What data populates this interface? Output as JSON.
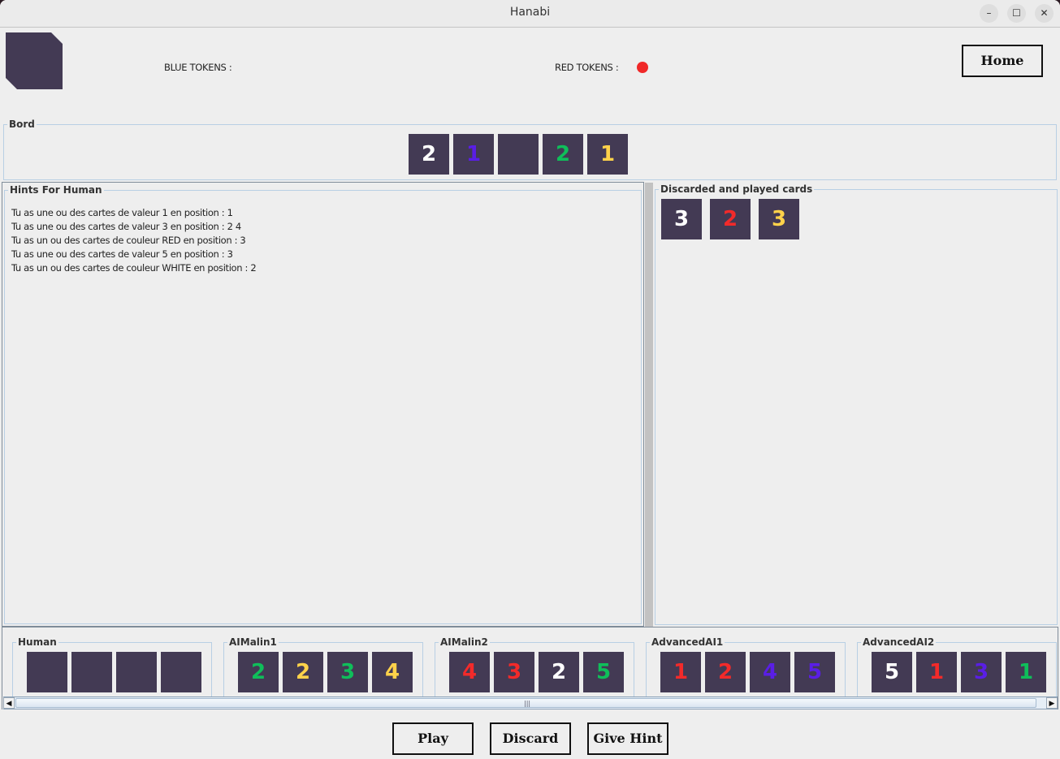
{
  "window": {
    "title": "Hanabi",
    "controls": {
      "minimize": "–",
      "maximize": "☐",
      "close": "✕"
    }
  },
  "header": {
    "blue_tokens_label": "BLUE TOKENS :",
    "red_tokens_label": "RED TOKENS :",
    "blue_tokens_count": 0,
    "red_tokens_count": 1,
    "home_label": "Home"
  },
  "colors": {
    "card_bg": "#433a54",
    "white": "#ffffff",
    "blue": "#5a1ee6",
    "green": "#0fbe5a",
    "yellow": "#ffd24a",
    "red": "#f22a2a",
    "red_token": "#f02828"
  },
  "bord": {
    "title": "Bord",
    "cards": [
      {
        "value": "2",
        "color": "white"
      },
      {
        "value": "1",
        "color": "blue"
      },
      {
        "value": "",
        "color": "none"
      },
      {
        "value": "2",
        "color": "green"
      },
      {
        "value": "1",
        "color": "yellow"
      }
    ]
  },
  "hints": {
    "title": "Hints For Human",
    "lines": [
      "Tu as une ou des cartes de valeur 1 en position : 1",
      "Tu as une ou des cartes de valeur 3 en position : 2 4",
      "Tu as un ou des cartes de couleur RED en position : 3",
      "Tu as une ou des cartes de valeur 5 en position : 3",
      "Tu as un ou des cartes de couleur WHITE en position : 2"
    ]
  },
  "discarded": {
    "title": "Discarded and played cards",
    "cards": [
      {
        "value": "3",
        "color": "white"
      },
      {
        "value": "2",
        "color": "red"
      },
      {
        "value": "3",
        "color": "yellow"
      }
    ]
  },
  "players": [
    {
      "name": "Human",
      "cards": [
        {
          "value": "",
          "color": "none"
        },
        {
          "value": "",
          "color": "none"
        },
        {
          "value": "",
          "color": "none"
        },
        {
          "value": "",
          "color": "none"
        }
      ]
    },
    {
      "name": "AIMalin1",
      "cards": [
        {
          "value": "2",
          "color": "green"
        },
        {
          "value": "2",
          "color": "yellow"
        },
        {
          "value": "3",
          "color": "green"
        },
        {
          "value": "4",
          "color": "yellow"
        }
      ]
    },
    {
      "name": "AIMalin2",
      "cards": [
        {
          "value": "4",
          "color": "red"
        },
        {
          "value": "3",
          "color": "red"
        },
        {
          "value": "2",
          "color": "white"
        },
        {
          "value": "5",
          "color": "green"
        }
      ]
    },
    {
      "name": "AdvancedAI1",
      "cards": [
        {
          "value": "1",
          "color": "red"
        },
        {
          "value": "2",
          "color": "red"
        },
        {
          "value": "4",
          "color": "blue"
        },
        {
          "value": "5",
          "color": "blue"
        }
      ]
    },
    {
      "name": "AdvancedAI2",
      "cards": [
        {
          "value": "5",
          "color": "white"
        },
        {
          "value": "1",
          "color": "red"
        },
        {
          "value": "3",
          "color": "blue"
        },
        {
          "value": "1",
          "color": "green"
        }
      ]
    }
  ],
  "scrollbar": {
    "left_arrow": "◀",
    "right_arrow": "▶",
    "grip": "|||"
  },
  "actions": {
    "play_label": "Play",
    "discard_label": "Discard",
    "give_hint_label": "Give Hint"
  }
}
